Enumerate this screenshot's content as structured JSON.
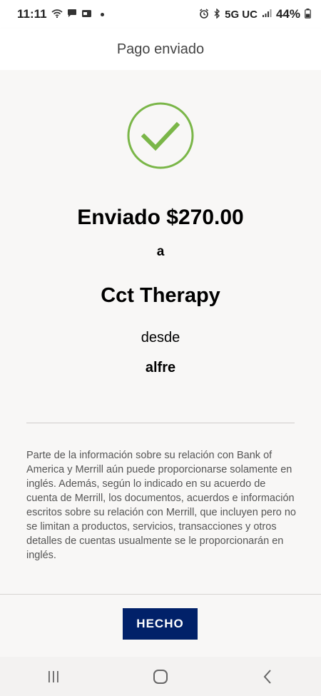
{
  "status_bar": {
    "time": "11:11",
    "network": "5G UC",
    "battery": "44%",
    "icons": [
      "wifi-icon",
      "chat-icon",
      "card-icon",
      "alarm-icon",
      "bluetooth-icon",
      "signal-icon",
      "battery-icon"
    ]
  },
  "header": {
    "title": "Pago enviado"
  },
  "confirmation": {
    "icon": "checkmark-circle-icon",
    "accent_color": "#7ab648",
    "sent_line": "Enviado $270.00",
    "to_label": "a",
    "recipient": "Cct Therapy",
    "from_label": "desde",
    "sender": "alfre"
  },
  "disclaimer": {
    "text": "Parte de la información sobre su relación con Bank of America y Merrill aún puede proporcionarse solamente en inglés. Además, según lo indicado en su acuerdo de cuenta de Merrill, los documentos, acuerdos e información escritos sobre su relación con Merrill, que incluyen pero no se limitan a productos, servicios, transacciones y otros detalles de cuentas usualmente se le proporcionarán en inglés."
  },
  "footer": {
    "done_label": "HECHO",
    "button_color": "#012169"
  },
  "nav_bar": {
    "items": [
      "recent-apps-icon",
      "home-icon",
      "back-icon"
    ]
  }
}
